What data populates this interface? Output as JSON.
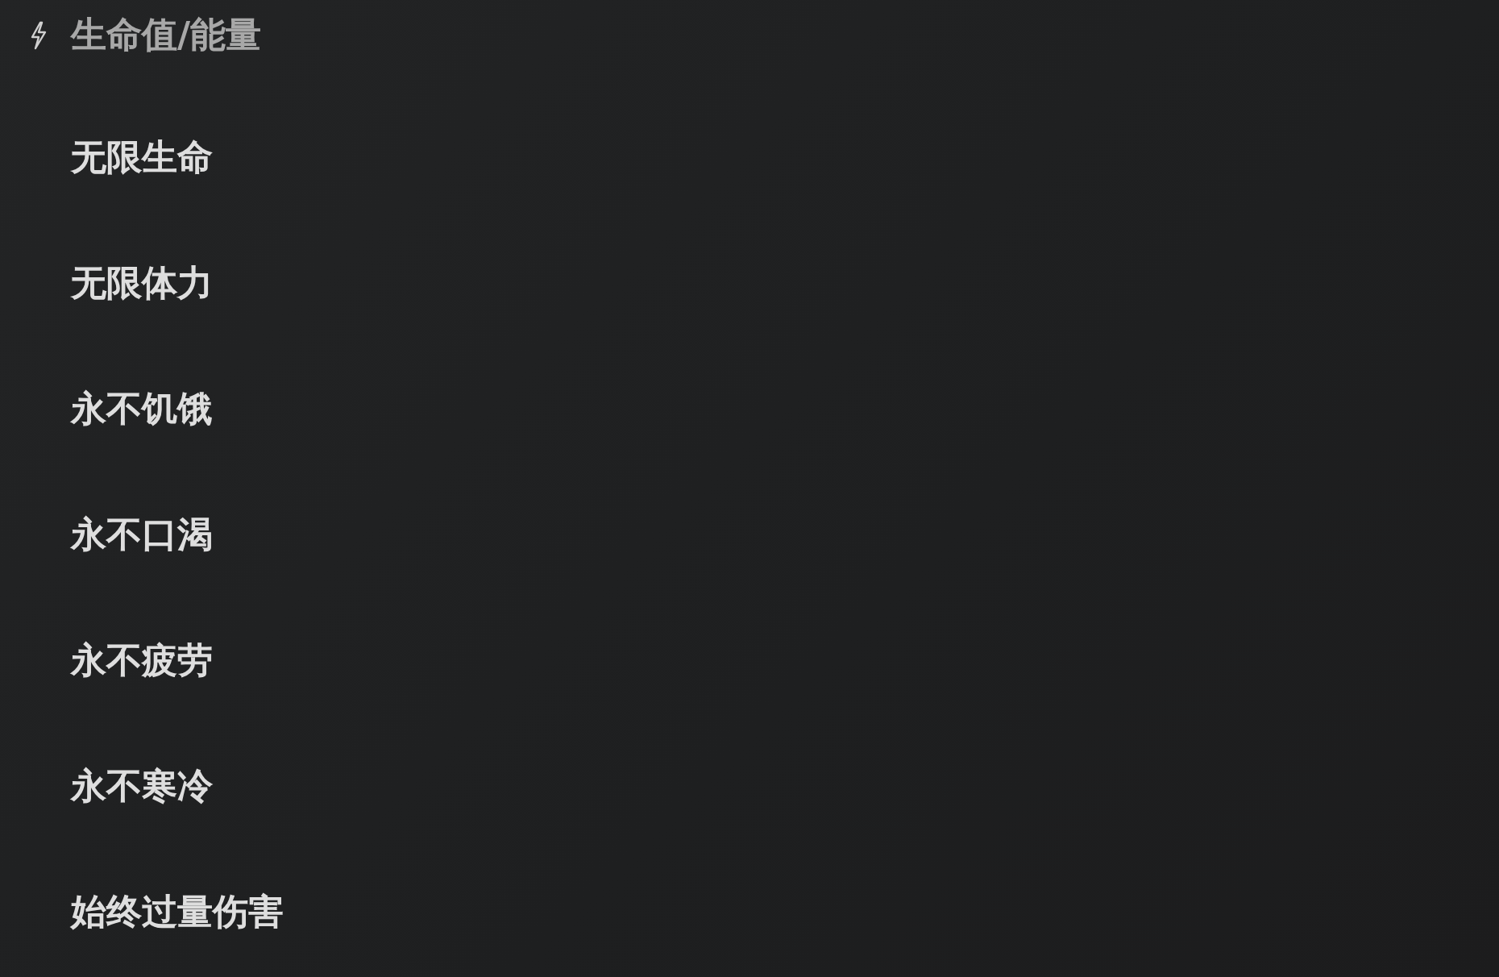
{
  "section": {
    "title": "生命值/能量"
  },
  "options": [
    {
      "label": "无限生命"
    },
    {
      "label": "无限体力"
    },
    {
      "label": "永不饥饿"
    },
    {
      "label": "永不口渴"
    },
    {
      "label": "永不疲劳"
    },
    {
      "label": "永不寒冷"
    },
    {
      "label": "始终过量伤害"
    }
  ]
}
